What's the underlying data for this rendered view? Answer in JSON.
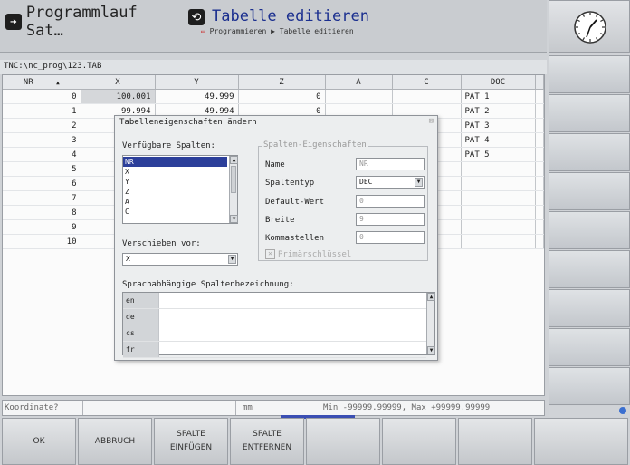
{
  "header": {
    "title_left": "Programmlauf Sat…",
    "title_main": "Tabelle editieren",
    "breadcrumb_1": "Programmieren",
    "breadcrumb_2": "Tabelle editieren"
  },
  "path": "TNC:\\nc_prog\\123.TAB",
  "table": {
    "columns": [
      "NR",
      "X",
      "Y",
      "Z",
      "A",
      "C",
      "DOC"
    ],
    "rows": [
      {
        "nr": "0",
        "x": "100.001",
        "y": "49.999",
        "z": "0",
        "a": "",
        "c": "",
        "doc": "PAT 1"
      },
      {
        "nr": "1",
        "x": "99.994",
        "y": "49.994",
        "z": "0",
        "a": "",
        "c": "",
        "doc": "PAT 2"
      },
      {
        "nr": "2",
        "x": "",
        "y": "",
        "z": "",
        "a": "",
        "c": "",
        "doc": "PAT 3"
      },
      {
        "nr": "3",
        "x": "",
        "y": "",
        "z": "",
        "a": "",
        "c": "",
        "doc": "PAT 4"
      },
      {
        "nr": "4",
        "x": "",
        "y": "",
        "z": "",
        "a": "",
        "c": "",
        "doc": "PAT 5"
      },
      {
        "nr": "5",
        "x": "",
        "y": "",
        "z": "",
        "a": "",
        "c": "",
        "doc": ""
      },
      {
        "nr": "6",
        "x": "",
        "y": "",
        "z": "",
        "a": "",
        "c": "",
        "doc": ""
      },
      {
        "nr": "7",
        "x": "",
        "y": "",
        "z": "",
        "a": "",
        "c": "",
        "doc": ""
      },
      {
        "nr": "8",
        "x": "",
        "y": "",
        "z": "",
        "a": "",
        "c": "",
        "doc": ""
      },
      {
        "nr": "9",
        "x": "",
        "y": "",
        "z": "",
        "a": "",
        "c": "",
        "doc": ""
      },
      {
        "nr": "10",
        "x": "",
        "y": "",
        "z": "",
        "a": "",
        "c": "",
        "doc": ""
      }
    ]
  },
  "dialog": {
    "title": "Tabelleneigenschaften ändern",
    "available_label": "Verfügbare Spalten:",
    "available_items": [
      "NR",
      "X",
      "Y",
      "Z",
      "A",
      "C"
    ],
    "move_label": "Verschieben vor:",
    "move_value": "X",
    "props_group": "Spalten-Eigenschaften",
    "name_label": "Name",
    "name_value": "NR",
    "type_label": "Spaltentyp",
    "type_value": "DEC",
    "default_label": "Default-Wert",
    "default_value": "0",
    "width_label": "Breite",
    "width_value": "9",
    "decimals_label": "Kommastellen",
    "decimals_value": "0",
    "primary_label": "Primärschlüssel",
    "lang_label": "Sprachabhängige Spaltenbezeichnung:",
    "languages": [
      "en",
      "de",
      "cs",
      "fr"
    ]
  },
  "status": {
    "prompt": "Koordinate?",
    "unit": "mm",
    "range": "Min -99999.99999, Max +99999.99999"
  },
  "softkeys": {
    "ok": "OK",
    "abbruch": "ABBRUCH",
    "insert_1": "SPALTE",
    "insert_2": "EINFÜGEN",
    "remove_1": "SPALTE",
    "remove_2": "ENTFERNEN"
  }
}
